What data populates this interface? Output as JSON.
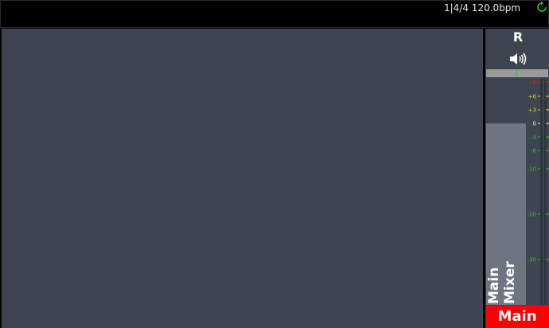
{
  "topbar": {
    "transport_position": "1|4/4 120.0bpm",
    "sync_icon": "refresh-icon",
    "sync_color": "#22cc22"
  },
  "mixer": {
    "record_label": "R",
    "speaker_icon": "speaker-volume-icon",
    "meter_ticks": [
      {
        "label": "+9",
        "color": "#dd2222",
        "db": 9
      },
      {
        "label": "+6",
        "color": "#d8d820",
        "db": 6
      },
      {
        "label": "+3",
        "color": "#d8d820",
        "db": 3
      },
      {
        "label": "0",
        "color": "#e8e8e8",
        "db": 0
      },
      {
        "label": "-3",
        "color": "#22cc22",
        "db": -3
      },
      {
        "label": "-6",
        "color": "#22cc22",
        "db": -6
      },
      {
        "label": "-10",
        "color": "#22cc22",
        "db": -10
      },
      {
        "label": "-20",
        "color": "#22cc22",
        "db": -20
      },
      {
        "label": "-30",
        "color": "#22cc22",
        "db": -30
      }
    ],
    "strip_name": "Main\nMixer",
    "bus_label": "Main",
    "bus_color": "#ff0000"
  }
}
